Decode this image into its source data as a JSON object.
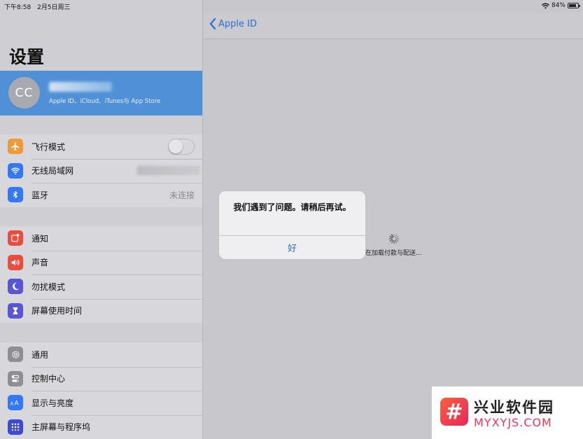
{
  "status": {
    "time": "下午8:58",
    "date": "2月5日周三",
    "battery": "84%",
    "battery_level": 0.84
  },
  "sidebar": {
    "title": "设置",
    "profile": {
      "initials": "CC",
      "subtitle": "Apple ID、iCloud、iTunes与 App Store"
    },
    "groups": [
      [
        {
          "label": "飞行模式",
          "icon": "airplane-icon",
          "color": "#f09a37"
        },
        {
          "label": "无线局域网",
          "icon": "wifi-icon",
          "color": "#3478f6"
        },
        {
          "label": "蓝牙",
          "icon": "bluetooth-icon",
          "color": "#3478f6",
          "value": "未连接"
        }
      ],
      [
        {
          "label": "通知",
          "icon": "notifications-icon",
          "color": "#eb4d3d"
        },
        {
          "label": "声音",
          "icon": "sound-icon",
          "color": "#eb4d3d"
        },
        {
          "label": "勿扰模式",
          "icon": "moon-icon",
          "color": "#5856d6"
        },
        {
          "label": "屏幕使用时间",
          "icon": "hourglass-icon",
          "color": "#5856d6"
        }
      ],
      [
        {
          "label": "通用",
          "icon": "gear-icon",
          "color": "#8e8e93"
        },
        {
          "label": "控制中心",
          "icon": "control-center-icon",
          "color": "#8e8e93"
        },
        {
          "label": "显示与亮度",
          "icon": "display-icon",
          "color": "#3478f6"
        },
        {
          "label": "主屏幕与程序坞",
          "icon": "home-screen-icon",
          "color": "#3b4bd8"
        }
      ]
    ]
  },
  "nav": {
    "back_label": "Apple ID"
  },
  "main": {
    "loading_text": "在加载付款与配送..."
  },
  "alert": {
    "message": "我们遇到了问题。请稍后再试。",
    "ok_label": "好"
  },
  "watermark": {
    "title": "兴业软件园",
    "url": "MYXYJS.COM",
    "logo": "#"
  },
  "colors": {
    "accent": "#2a6fd1",
    "selected_row": "#4f90d6"
  }
}
